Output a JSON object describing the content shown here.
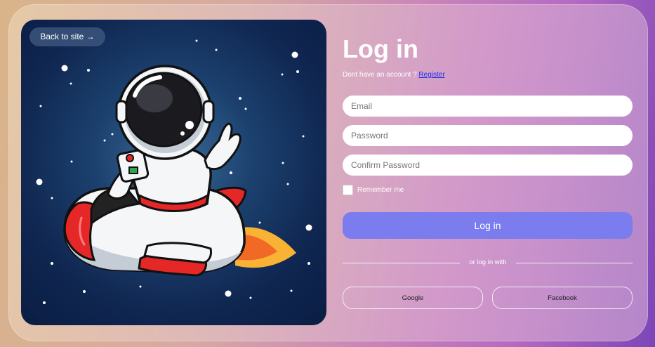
{
  "hero": {
    "back_label": "Back to site →",
    "image_icon": "astronaut-riding-rocket-illustration"
  },
  "form": {
    "title": "Log in",
    "no_account_text": "Dont have an account ?",
    "register_link": "Register",
    "email_placeholder": "Email",
    "password_placeholder": "Password",
    "confirm_placeholder": "Confirm Password",
    "remember_label": "Remember me",
    "submit_label": "Log in",
    "divider_text": "or log in with",
    "google_label": "Google",
    "facebook_label": "Facebook"
  },
  "colors": {
    "accent": "#7b7cee",
    "link": "#1a2eea",
    "art_background": "#0f2650"
  }
}
